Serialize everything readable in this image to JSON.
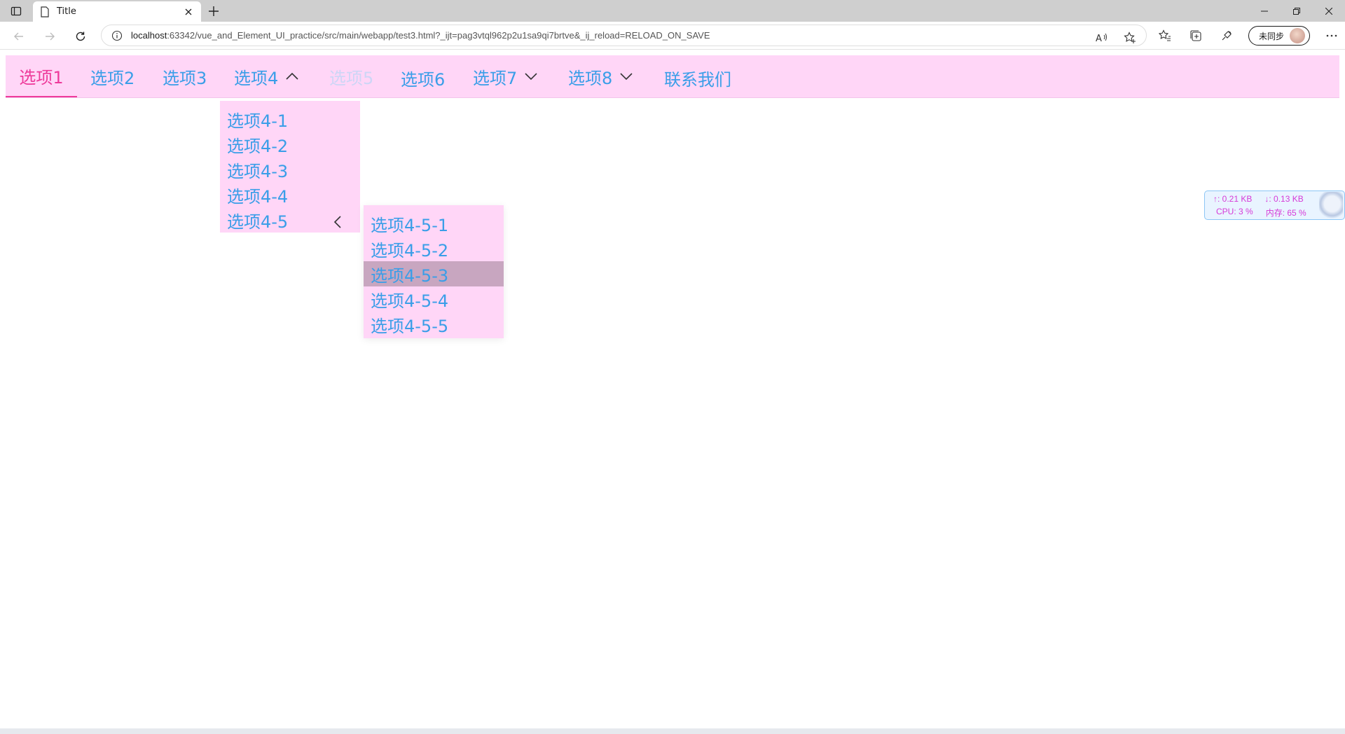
{
  "browser": {
    "tab_title": "Title",
    "url_host": "localhost",
    "url_rest": ":63342/vue_and_Element_UI_practice/src/main/webapp/test3.html?_ijt=pag3vtql962p2u1sa9qi7brtve&_ij_reload=RELOAD_ON_SAVE",
    "profile_label": "未同步"
  },
  "menu": {
    "items": [
      {
        "label": "选项1",
        "state": "active"
      },
      {
        "label": "选项2"
      },
      {
        "label": "选项3"
      },
      {
        "label": "选项4",
        "submenu": "open"
      },
      {
        "label": "选项5",
        "state": "disabled"
      },
      {
        "label": "选项6"
      },
      {
        "label": "选项7",
        "submenu": "closed"
      },
      {
        "label": "选项8",
        "submenu": "closed"
      },
      {
        "label": "联系我们"
      }
    ]
  },
  "dropdown": {
    "items": [
      "选项4-1",
      "选项4-2",
      "选项4-3",
      "选项4-4",
      "选项4-5"
    ]
  },
  "subdropdown": {
    "items": [
      "选项4-5-1",
      "选项4-5-2",
      "选项4-5-3",
      "选项4-5-4",
      "选项4-5-5"
    ],
    "hovered_index": 2
  },
  "monitor": {
    "upload": "↑: 0.21 KB",
    "download": "↓: 0.13 KB",
    "cpu": "CPU: 3 %",
    "memory": "内存: 65 %"
  },
  "colors": {
    "menu_bg": "#ffd6f7",
    "menu_text": "#3a9ee8",
    "active_text": "#ee3a9a",
    "hover_bg": "#c8a6c0"
  },
  "icons": [
    "sidebar-icon",
    "page-icon",
    "close-icon",
    "plus-icon",
    "back-icon",
    "forward-icon",
    "refresh-icon",
    "info-icon",
    "read-aloud-icon",
    "add-favorite-icon",
    "favorites-icon",
    "collections-icon",
    "extensions-icon",
    "more-icon",
    "chevron-up-icon",
    "chevron-down-icon",
    "chevron-left-icon"
  ]
}
